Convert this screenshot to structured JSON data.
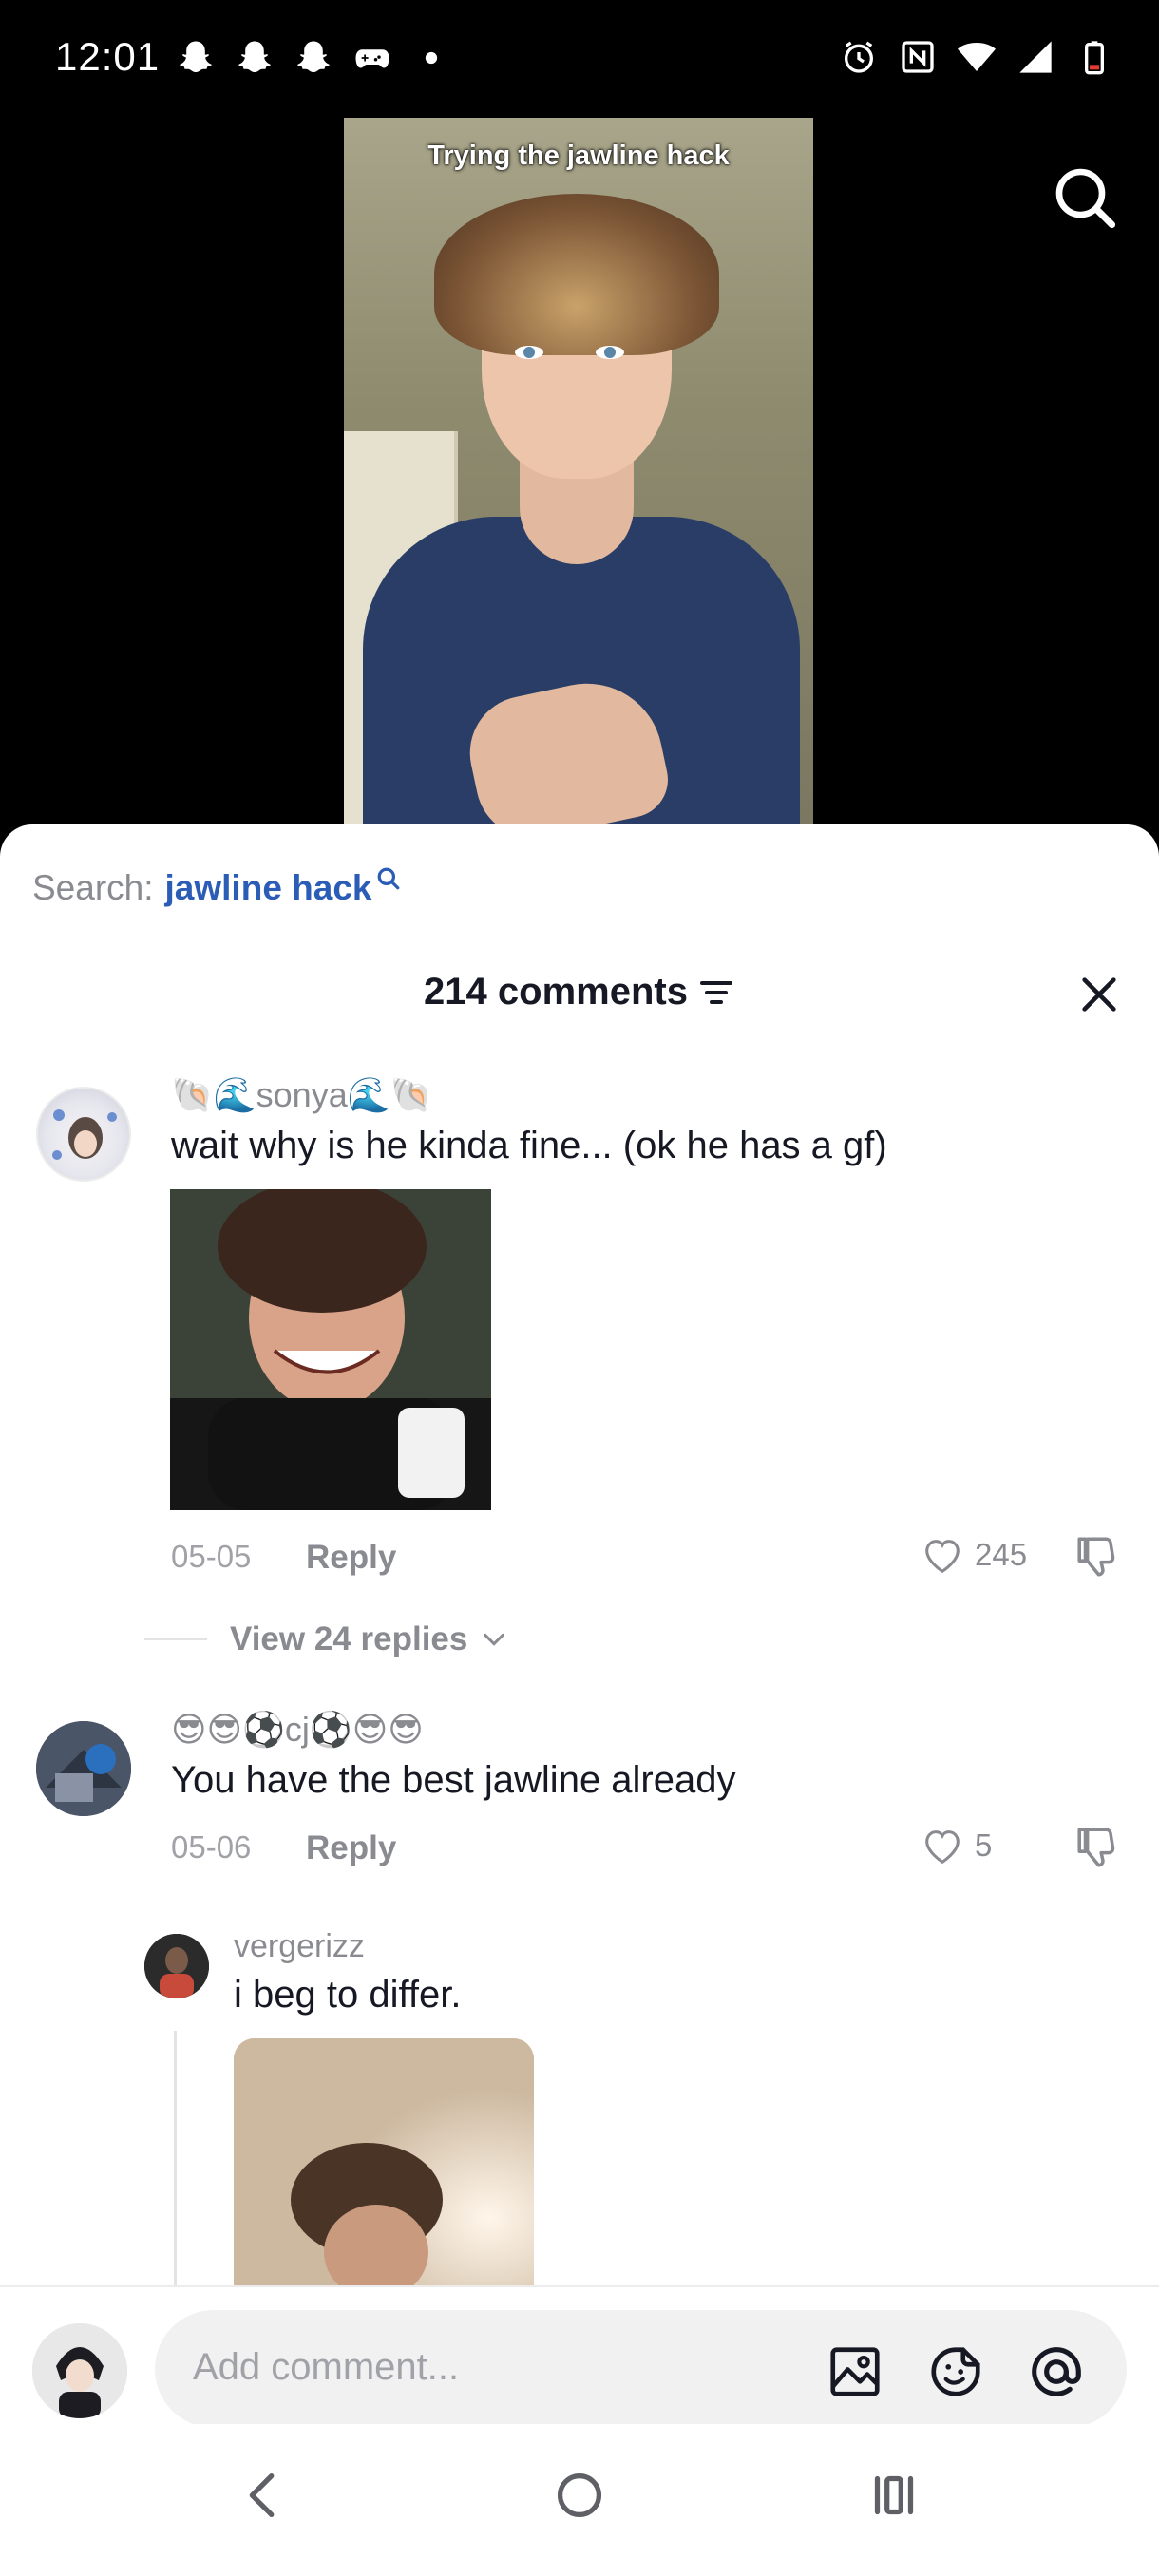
{
  "status_bar": {
    "time": "12:01",
    "left_icons": [
      "snapchat-ghost-icon",
      "snapchat-ghost-icon",
      "snapchat-ghost-icon",
      "game-controller-icon",
      "dot-icon"
    ],
    "right_icons": [
      "alarm-icon",
      "nfc-icon",
      "wifi-icon",
      "signal-icon",
      "battery-low-icon"
    ]
  },
  "video": {
    "caption": "Trying the jawline hack"
  },
  "search": {
    "prefix": "Search:",
    "term": "jawline hack"
  },
  "comments_header": {
    "title": "214 comments"
  },
  "comments": [
    {
      "username": "🐚🌊sonya🌊🐚",
      "text": "wait why is he kinda fine... (ok he has a gf)",
      "date": "05-05",
      "reply_label": "Reply",
      "likes": "245",
      "view_replies": "View 24 replies"
    },
    {
      "username": "😎😎⚽cj⚽😎😎",
      "text": "You have the best jawline already",
      "date": "05-06",
      "reply_label": "Reply",
      "likes": "5"
    }
  ],
  "reply": {
    "username": "vergerizz",
    "text": "i beg to differ."
  },
  "input_bar": {
    "placeholder": "Add comment..."
  },
  "colors": {
    "accent_blue": "#2b5db6",
    "text_primary": "#161823",
    "text_secondary": "#8a8b91"
  }
}
